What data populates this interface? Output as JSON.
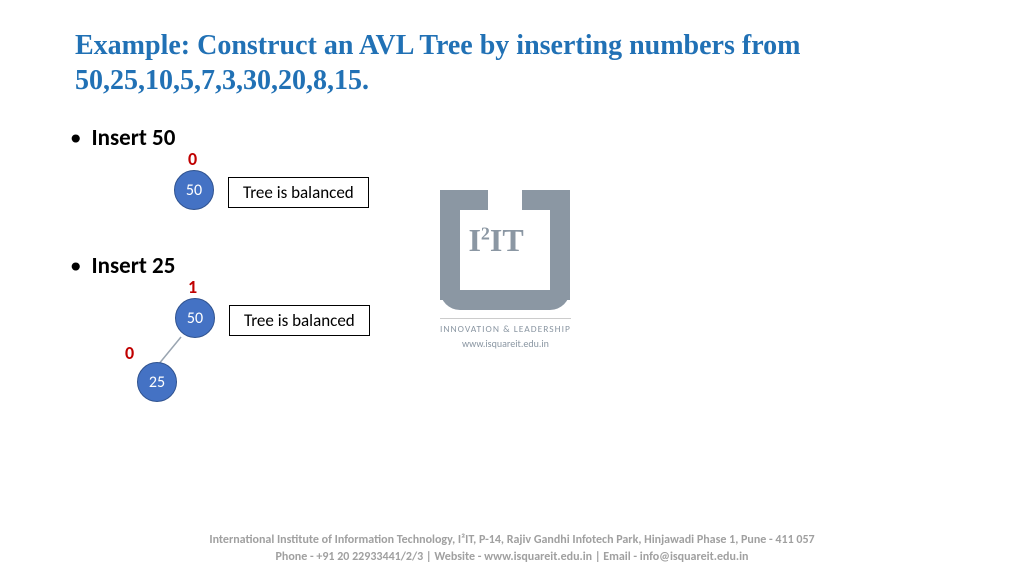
{
  "title": "Example: Construct an AVL Tree by inserting numbers from 50,25,10,5,7,3,30,20,8,15.",
  "section1": {
    "heading": "Insert 50",
    "node1_value": "50",
    "node1_bf": "0",
    "status": "Tree is balanced"
  },
  "section2": {
    "heading": "Insert 25",
    "node1_value": "50",
    "node1_bf": "1",
    "node2_value": "25",
    "node2_bf": "0",
    "status": "Tree is balanced"
  },
  "logo": {
    "text_before_sup": "I",
    "sup": "2",
    "text_after_sup": "IT",
    "tagline": "INNOVATION & LEADERSHIP",
    "url": "www.isquareit.edu.in"
  },
  "footer": {
    "line1": "International Institute of Information Technology, I²IT, P-14, Rajiv Gandhi Infotech Park, Hinjawadi Phase 1, Pune - 411 057",
    "line2": "Phone - +91 20 22933441/2/3 | Website - www.isquareit.edu.in | Email - info@isquareit.edu.in"
  }
}
